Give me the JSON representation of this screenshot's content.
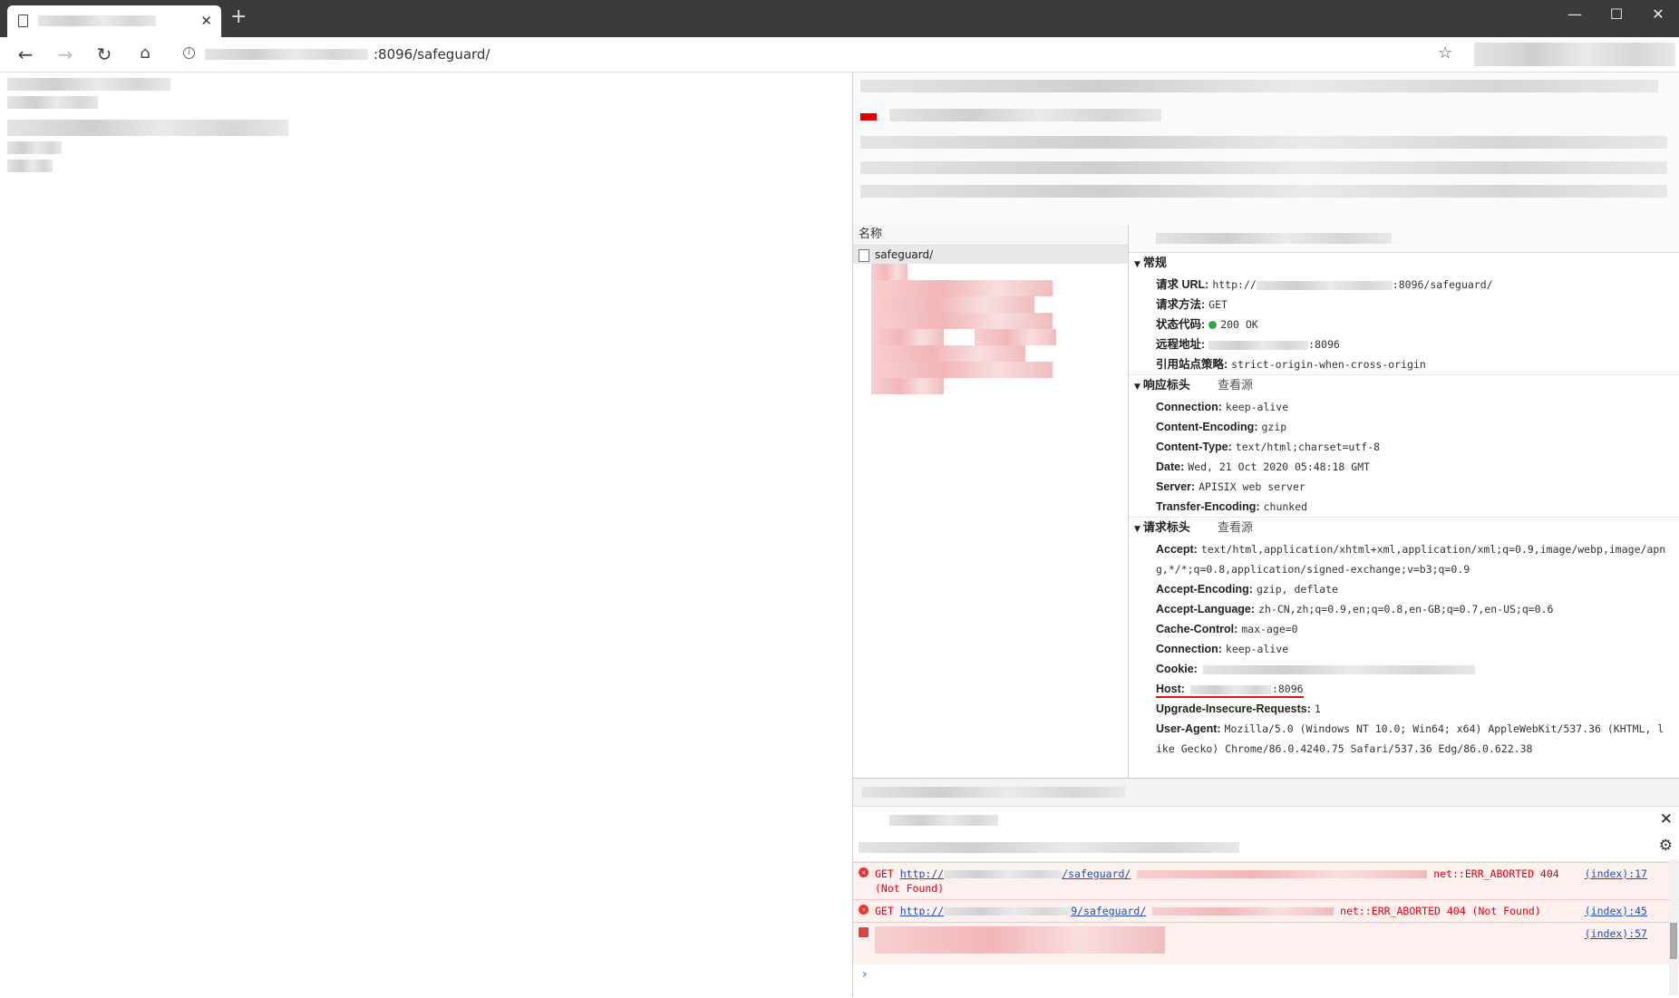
{
  "browser": {
    "tab_title": "",
    "address": {
      "visible_text": ":8096/safeguard/"
    }
  },
  "devtools": {
    "network": {
      "name_header": "名称",
      "selected_request": "safeguard/"
    },
    "general": {
      "title": "常规",
      "request_url_label": "请求 URL:",
      "request_url_prefix": "http://",
      "request_url_suffix": ":8096/safeguard/",
      "method_label": "请求方法:",
      "method_value": "GET",
      "status_label": "状态代码:",
      "status_value": "200 OK",
      "status_color": "#2ca944",
      "remote_label": "远程地址:",
      "remote_value": ":8096",
      "referrer_label": "引用站点策略:",
      "referrer_value": "strict-origin-when-cross-origin"
    },
    "response_headers": {
      "title": "响应标头",
      "view_source": "查看源",
      "items": [
        {
          "k": "Connection:",
          "v": "keep-alive"
        },
        {
          "k": "Content-Encoding:",
          "v": "gzip"
        },
        {
          "k": "Content-Type:",
          "v": "text/html;charset=utf-8"
        },
        {
          "k": "Date:",
          "v": "Wed, 21 Oct 2020 05:48:18 GMT"
        },
        {
          "k": "Server:",
          "v": "APISIX web server"
        },
        {
          "k": "Transfer-Encoding:",
          "v": "chunked"
        }
      ]
    },
    "request_headers": {
      "title": "请求标头",
      "view_source": "查看源",
      "accept_k": "Accept:",
      "accept_v1": "text/html,application/xhtml+xml,application/xml;q=0.9,image/webp,image/apn",
      "accept_v2": "g,*/*;q=0.8,application/signed-exchange;v=b3;q=0.9",
      "accept_encoding_k": "Accept-Encoding:",
      "accept_encoding_v": "gzip, deflate",
      "accept_language_k": "Accept-Language:",
      "accept_language_v": "zh-CN,zh;q=0.9,en;q=0.8,en-GB;q=0.7,en-US;q=0.6",
      "cache_control_k": "Cache-Control:",
      "cache_control_v": "max-age=0",
      "connection_k": "Connection:",
      "connection_v": "keep-alive",
      "cookie_k": "Cookie:",
      "host_k": "Host:",
      "host_v": ":8096",
      "upgrade_k": "Upgrade-Insecure-Requests:",
      "upgrade_v": "1",
      "ua_k": "User-Agent:",
      "ua_v1": "Mozilla/5.0 (Windows NT 10.0; Win64; x64) AppleWebKit/537.36 (KHTML, l",
      "ua_v2": "ike Gecko) Chrome/86.0.4240.75 Safari/537.36 Edg/86.0.622.38"
    },
    "console": {
      "messages": [
        {
          "method": "GET",
          "url_prefix": "http://",
          "url_path": "/safeguard/",
          "error": "net::ERR_ABORTED 404",
          "error2": "(Not Found)",
          "source": "(index):17"
        },
        {
          "method": "GET",
          "url_prefix": "http://",
          "url_path": "9/safeguard/",
          "error": "net::ERR_ABORTED 404 (Not Found)",
          "source": "(index):45"
        },
        {
          "source": "(index):57"
        }
      ],
      "prompt": "›"
    }
  }
}
